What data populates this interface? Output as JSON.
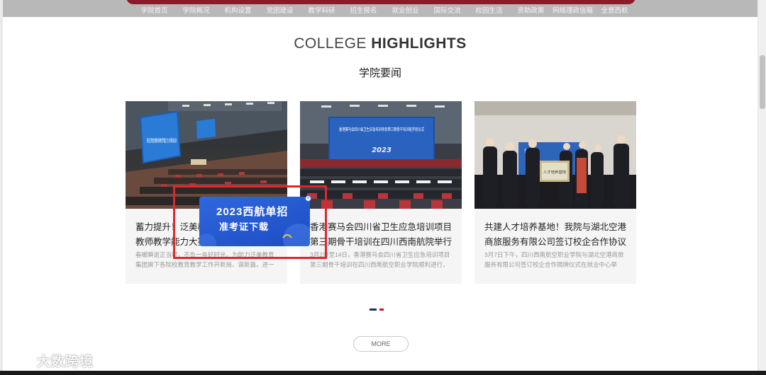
{
  "nav": {
    "items": [
      "学院首页",
      "学院概况",
      "机构设置",
      "党团建设",
      "教学科研",
      "招生报名",
      "就业创业",
      "国际交流",
      "校园生活",
      "资助政策",
      "网络理政信箱",
      "全景西航"
    ]
  },
  "section": {
    "heading_light": "COLLEGE ",
    "heading_bold": "HIGHLIGHTS",
    "subheading": "学院要闻"
  },
  "cards": [
    {
      "title": "蓄力提升！泛美教育集团旗下各院校教师教学能力大赛培训",
      "desc": "春暖瞬逝正当时，不负一年好时光。为助力泛美教育集团旗下各院校教育教学工作开新局、谋新篇，进一步提升..."
    },
    {
      "title": "香港赛马会四川省卫生应急培训项目第三期骨干培训在四川西南航院举行",
      "desc": "3月2日至14日，香港赛马会四川省卫生应急培训项目第三期骨干培训在四川西南航空职业学院顺利进行，来自四..."
    },
    {
      "title": "共建人才培养基地！我院与湖北空港商旅服务有限公司签订校企合作协议",
      "desc": "3月7日下午，四川西南航空职业学院与湖北空港商旅服务有限公司签订校企合作揭牌仪式在就业中心举行。根据..."
    }
  ],
  "image_text": {
    "card1_screen": "职业院校教师教学能力大赛培训",
    "card2_banner": "香港赛马会四川省卫生应急培训项目第三期骨干培训班开班仪式",
    "card2_year": "2023",
    "card3_banner": "仪式",
    "card3_plaque": "人才培养基地"
  },
  "popup": {
    "line1": "2023西航单招",
    "line2": "准考证下载",
    "close": "×"
  },
  "more_label": "MORE",
  "watermark": "大数跨境",
  "colors": {
    "nav_bar": "#8a1b2b",
    "popup": "#2f67df",
    "highlight": "#e0262f",
    "dot_active": "#1f2f5e",
    "dot_inactive": "#c8102e"
  }
}
